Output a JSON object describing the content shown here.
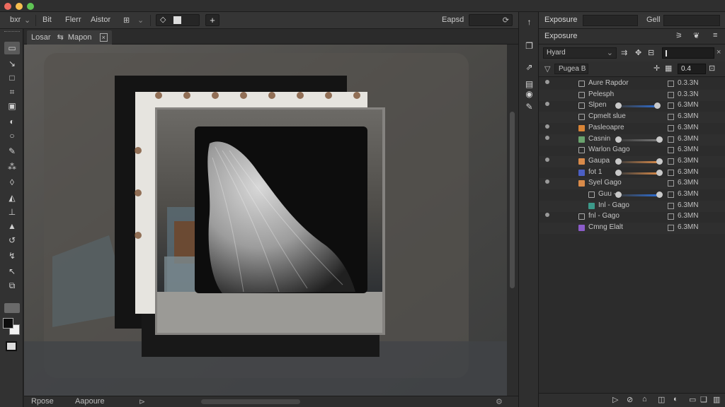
{
  "window": {
    "lights": [
      "#ed6b5f",
      "#f6be4f",
      "#5fc454"
    ]
  },
  "options_bar": {
    "items": [
      "bxr",
      "Bit",
      "Flerr",
      "Aistor"
    ],
    "blend_label": "Eapsd"
  },
  "tools": [
    "marquee-icon",
    "lasso-icon",
    "rect-icon",
    "crop-icon",
    "frame-icon",
    "brush-icon",
    "ellipse-icon",
    "pen-icon",
    "clone-icon",
    "eraser-icon",
    "fill-icon",
    "dodge-icon",
    "type-icon",
    "path-icon",
    "hand-icon",
    "zoom-icon",
    "extra-icon"
  ],
  "document": {
    "tab_label": "Losar",
    "tab_name": "Mapon",
    "status_left": "Rpose",
    "status_right": "Aapoure"
  },
  "panel": {
    "header_title": "Exposure",
    "header_right": "Gell",
    "tab_label": "Exposure",
    "blend_mode": "Hyard",
    "filter_label": "Pugea B",
    "opacity": "0.4",
    "layers": [
      {
        "name": "Aure Rapdor",
        "swatch": "",
        "value": "0.3.3N",
        "slider": null
      },
      {
        "name": "Pelesph",
        "swatch": "",
        "value": "0.3.3N",
        "slider": null
      },
      {
        "name": "Slpen",
        "swatch": "",
        "value": "6.3MN",
        "slider": {
          "color": "#2e6fd6",
          "level": 0.95
        }
      },
      {
        "name": "Cpmelt slue",
        "swatch": "",
        "value": "6.3MN",
        "slider": null
      },
      {
        "name": "Pasleoapre",
        "swatch": "#d88436",
        "value": "6.3MN",
        "slider": null
      },
      {
        "name": "Casnin",
        "swatch": "#6aa36e",
        "value": "6.3MN",
        "slider": {
          "color": "#777777",
          "level": 1.0
        }
      },
      {
        "name": "Warlon Gago",
        "swatch": "",
        "value": "6.3MN",
        "slider": null
      },
      {
        "name": "Gaupa",
        "swatch": "#d98b4a",
        "value": "6.3MN",
        "slider": {
          "color": "#d98b4a",
          "level": 1.0
        }
      },
      {
        "name": "fot 1",
        "swatch": "#4b5fc4",
        "value": "6.3MN",
        "slider": {
          "color": "#d98b4a",
          "level": 1.0
        }
      },
      {
        "name": "Syel Gago",
        "swatch": "#d98b4a",
        "value": "6.3MN",
        "slider": null
      },
      {
        "name": "Guu -",
        "swatch": "",
        "value": "6.3MN",
        "slider": {
          "color": "#2e6fd6",
          "level": 1.0
        }
      },
      {
        "name": "Inl - Gago",
        "swatch": "#3c9a8a",
        "value": "6.3MN",
        "slider": null
      },
      {
        "name": "fnl - Gago",
        "swatch": "",
        "value": "6.3MN",
        "slider": null
      },
      {
        "name": "Cmng   Elalt",
        "swatch": "#8b5cc9",
        "value": "6.3MN",
        "slider": null
      }
    ]
  }
}
